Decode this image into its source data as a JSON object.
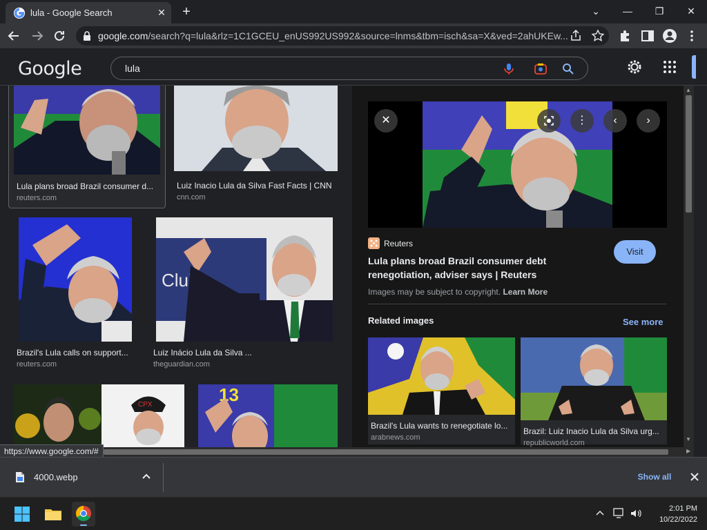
{
  "browser": {
    "tab_title": "lula - Google Search",
    "new_tab": "+",
    "url_host": "google.com",
    "url_path": "/search?q=lula&rlz=1C1GCEU_enUS992US992&source=lnms&tbm=isch&sa=X&ved=2ahUKEw..."
  },
  "google": {
    "logo": "Google",
    "query": "lula"
  },
  "results": [
    {
      "caption": "Lula plans broad Brazil consumer d...",
      "source": "reuters.com"
    },
    {
      "caption": "Luiz Inacio Lula da Silva Fast Facts | CNN",
      "source": "cnn.com"
    },
    {
      "caption": "Brazil's Lula calls on support...",
      "source": "reuters.com"
    },
    {
      "caption": "Luiz Inácio Lula da Silva ...",
      "source": "theguardian.com"
    }
  ],
  "thumb_text": {
    "club_sign": "Club",
    "cap_text": "CPX",
    "number_13": "13"
  },
  "preview": {
    "source_name": "Reuters",
    "title_line1": "Lula plans broad Brazil consumer debt",
    "title_line2": "renegotiation, adviser says | Reuters",
    "visit_label": "Visit",
    "copyright_text": "Images may be subject to copyright.",
    "learn_more": "Learn More",
    "related_heading": "Related images",
    "see_more": "See more",
    "related": [
      {
        "caption": "Brazil's Lula wants to renegotiate lo...",
        "source": "arabnews.com"
      },
      {
        "caption": "Brazil: Luiz Inacio Lula da Silva urg...",
        "source": "republicworld.com"
      }
    ]
  },
  "status_url": "https://www.google.com/#",
  "download": {
    "filename": "4000.webp",
    "show_all": "Show all"
  },
  "taskbar": {
    "time": "2:01 PM",
    "date": "10/22/2022"
  },
  "colors": {
    "accent_blue": "#8ab4f8",
    "background": "#202124",
    "toolbar": "#35363a"
  }
}
